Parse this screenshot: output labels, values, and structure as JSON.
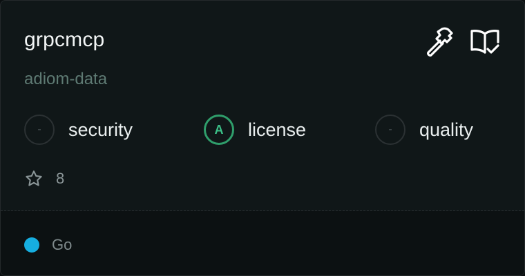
{
  "repo": {
    "name": "grpcmcp",
    "owner": "adiom-data"
  },
  "actions": [
    {
      "icon": "hammer-icon"
    },
    {
      "icon": "book-check-icon"
    }
  ],
  "scores": [
    {
      "grade": "-",
      "label": "security"
    },
    {
      "grade": "A",
      "label": "license"
    },
    {
      "grade": "-",
      "label": "quality"
    }
  ],
  "stars": {
    "icon": "star-icon",
    "count": "8"
  },
  "language": {
    "name": "Go",
    "color": "#16aee0"
  },
  "colors": {
    "background": "#101718",
    "footer": "#0c1112",
    "accent_green": "#2f9e6b",
    "subtitle": "#5e7a73"
  }
}
